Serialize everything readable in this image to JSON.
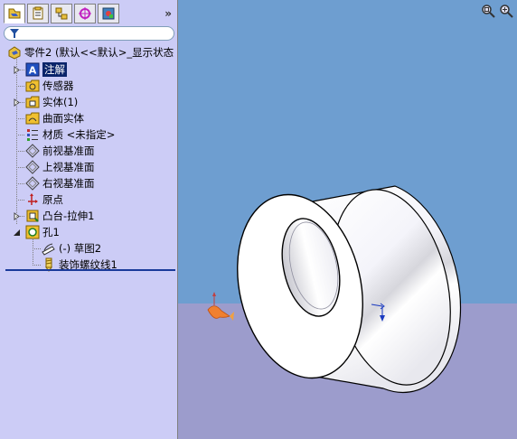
{
  "panel": {
    "tabs": [
      "featuremanager-tab",
      "propertymanager-tab",
      "configurationmanager-tab",
      "dimxpert-tab",
      "display-tab"
    ],
    "more_label": "»"
  },
  "tree": {
    "root": "零件2  (默认<<默认>_显示状态",
    "items": [
      {
        "label": "注解",
        "icon": "annotations-icon"
      },
      {
        "label": "传感器",
        "icon": "sensor-icon"
      },
      {
        "label": "实体(1)",
        "icon": "solid-bodies-icon"
      },
      {
        "label": "曲面实体",
        "icon": "surface-bodies-icon"
      },
      {
        "label": "材质 <未指定>",
        "icon": "material-icon"
      },
      {
        "label": "前视基准面",
        "icon": "plane-icon"
      },
      {
        "label": "上视基准面",
        "icon": "plane-icon"
      },
      {
        "label": "右视基准面",
        "icon": "plane-icon"
      },
      {
        "label": "原点",
        "icon": "origin-icon"
      },
      {
        "label": "凸台-拉伸1",
        "icon": "extrude-icon"
      },
      {
        "label": "孔1",
        "icon": "hole-icon"
      },
      {
        "label": "(-) 草图2",
        "icon": "sketch-icon"
      },
      {
        "label": "装饰螺纹线1",
        "icon": "cosmetic-thread-icon"
      }
    ]
  },
  "colors": {
    "panel_bg": "#ccccf6",
    "sky": "#6e9ed0",
    "floor": "#9c9ccc",
    "selection": "#0a246a"
  }
}
